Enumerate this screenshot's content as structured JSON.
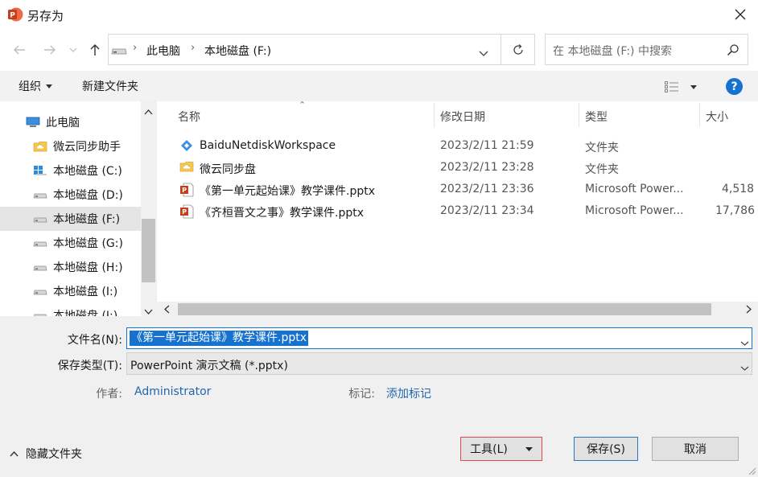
{
  "window": {
    "title": "另存为"
  },
  "nav": {
    "breadcrumb": [
      "此电脑",
      "本地磁盘 (F:)"
    ]
  },
  "search": {
    "placeholder": "在 本地磁盘 (F:) 中搜索"
  },
  "toolbar": {
    "organize_label": "组织",
    "new_folder_label": "新建文件夹",
    "help_label": "?"
  },
  "sidebar": {
    "items": [
      {
        "label": "此电脑",
        "icon": "computer-icon"
      },
      {
        "label": "微云同步助手",
        "icon": "cloud-folder-icon"
      },
      {
        "label": "本地磁盘 (C:)",
        "icon": "windows-drive-icon"
      },
      {
        "label": "本地磁盘 (D:)",
        "icon": "drive-icon"
      },
      {
        "label": "本地磁盘 (F:)",
        "icon": "drive-icon",
        "selected": true
      },
      {
        "label": "本地磁盘 (G:)",
        "icon": "drive-icon"
      },
      {
        "label": "本地磁盘 (H:)",
        "icon": "drive-icon"
      },
      {
        "label": "本地磁盘 (I:)",
        "icon": "drive-icon"
      },
      {
        "label": "本地磁盘 (J:)",
        "icon": "drive-icon"
      }
    ]
  },
  "files": {
    "columns": [
      "名称",
      "修改日期",
      "类型",
      "大小"
    ],
    "rows": [
      {
        "name": "BaiduNetdiskWorkspace",
        "date": "2023/2/11 21:59",
        "type": "文件夹",
        "size": "",
        "icon": "baidu-folder-icon"
      },
      {
        "name": "微云同步盘",
        "date": "2023/2/11 23:28",
        "type": "文件夹",
        "size": "",
        "icon": "cloud-folder-icon"
      },
      {
        "name": "《第一单元起始课》教学课件.pptx",
        "date": "2023/2/11 23:36",
        "type": "Microsoft Power...",
        "size": "4,518",
        "icon": "pptx-file-icon"
      },
      {
        "name": "《齐桓晋文之事》教学课件.pptx",
        "date": "2023/2/11 23:34",
        "type": "Microsoft Power...",
        "size": "17,786",
        "icon": "pptx-file-icon"
      }
    ]
  },
  "form": {
    "filename_label": "文件名(N):",
    "filename_value": "《第一单元起始课》教学课件.pptx",
    "filetype_label": "保存类型(T):",
    "filetype_value": "PowerPoint 演示文稿 (*.pptx)",
    "author_label": "作者:",
    "author_value": "Administrator",
    "tags_label": "标记:",
    "tags_value": "添加标记"
  },
  "footer": {
    "hide_folders_label": "隐藏文件夹",
    "tools_label": "工具(L)",
    "save_label": "保存(S)",
    "cancel_label": "取消"
  },
  "colors": {
    "accent": "#1672d0",
    "selection": "#e5e5e5",
    "ppt_red": "#c43e1c"
  }
}
